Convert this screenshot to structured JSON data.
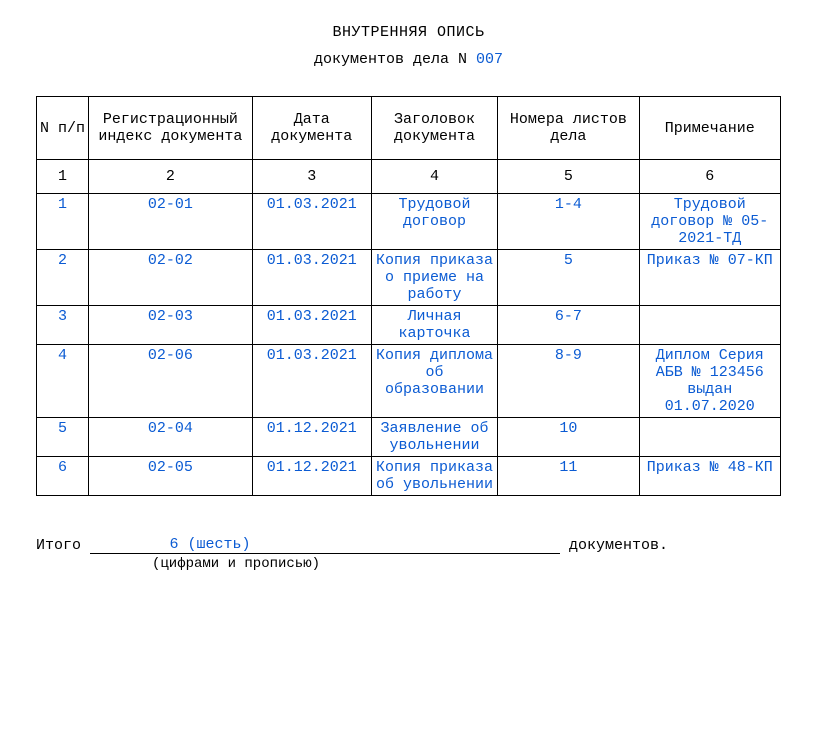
{
  "title": {
    "line1": "ВНУТРЕННЯЯ ОПИСЬ",
    "line2_prefix": "документов дела N ",
    "case_number": "007"
  },
  "headers": {
    "c1": "N п/п",
    "c2": "Регистрационный индекс документа",
    "c3": "Дата документа",
    "c4": "Заголовок документа",
    "c5": "Номера листов дела",
    "c6": "Примечание"
  },
  "numrow": {
    "c1": "1",
    "c2": "2",
    "c3": "3",
    "c4": "4",
    "c5": "5",
    "c6": "6"
  },
  "rows": [
    {
      "n": "1",
      "index": "02-01",
      "date": "01.03.2021",
      "title": "Трудовой договор",
      "sheets": "1-4",
      "note": "Трудовой договор № 05-2021-ТД"
    },
    {
      "n": "2",
      "index": "02-02",
      "date": "01.03.2021",
      "title": "Копия приказа о приеме на работу",
      "sheets": "5",
      "note": "Приказ № 07-КП"
    },
    {
      "n": "3",
      "index": "02-03",
      "date": "01.03.2021",
      "title": "Личная карточка",
      "sheets": "6-7",
      "note": ""
    },
    {
      "n": "4",
      "index": "02-06",
      "date": "01.03.2021",
      "title": "Копия диплома об образовании",
      "sheets": "8-9",
      "note": "Диплом Серия АБВ № 123456 выдан 01.07.2020"
    },
    {
      "n": "5",
      "index": "02-04",
      "date": "01.12.2021",
      "title": "Заявление об увольнении",
      "sheets": "10",
      "note": ""
    },
    {
      "n": "6",
      "index": "02-05",
      "date": "01.12.2021",
      "title": "Копия приказа об увольнении",
      "sheets": "11",
      "note": "Приказ № 48-КП"
    }
  ],
  "totals": {
    "label": "Итого ",
    "value": "6 (шесть)",
    "suffix": " документов.",
    "caption": "(цифрами и прописью)"
  },
  "chart_data": {
    "type": "table",
    "title": "ВНУТРЕННЯЯ ОПИСЬ документов дела N 007",
    "columns": [
      "N п/п",
      "Регистрационный индекс документа",
      "Дата документа",
      "Заголовок документа",
      "Номера листов дела",
      "Примечание"
    ],
    "rows": [
      [
        "1",
        "02-01",
        "01.03.2021",
        "Трудовой договор",
        "1-4",
        "Трудовой договор № 05-2021-ТД"
      ],
      [
        "2",
        "02-02",
        "01.03.2021",
        "Копия приказа о приеме на работу",
        "5",
        "Приказ № 07-КП"
      ],
      [
        "3",
        "02-03",
        "01.03.2021",
        "Личная карточка",
        "6-7",
        ""
      ],
      [
        "4",
        "02-06",
        "01.03.2021",
        "Копия диплома об образовании",
        "8-9",
        "Диплом Серия АБВ № 123456 выдан 01.07.2020"
      ],
      [
        "5",
        "02-04",
        "01.12.2021",
        "Заявление об увольнении",
        "10",
        ""
      ],
      [
        "6",
        "02-05",
        "01.12.2021",
        "Копия приказа об увольнении",
        "11",
        "Приказ № 48-КП"
      ]
    ],
    "total_documents": 6,
    "total_documents_words": "шесть"
  }
}
